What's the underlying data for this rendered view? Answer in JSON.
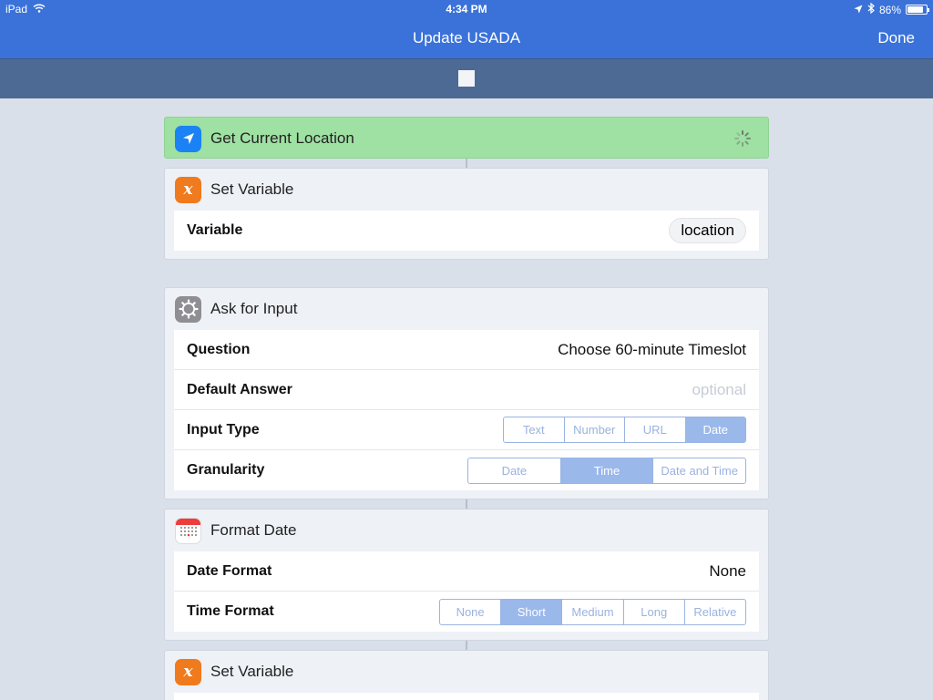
{
  "status": {
    "device": "iPad",
    "time": "4:34 PM",
    "battery": "86%",
    "battery_level": 0.86
  },
  "nav": {
    "title": "Update USADA",
    "done": "Done"
  },
  "actions": {
    "get_location": {
      "title": "Get Current Location",
      "color": "#9fe0a3"
    },
    "set_variable_1": {
      "title": "Set Variable",
      "variable_label": "Variable",
      "variable_value": "location"
    },
    "ask_input": {
      "title": "Ask for Input",
      "question_label": "Question",
      "question_value": "Choose 60-minute Timeslot",
      "default_label": "Default Answer",
      "default_placeholder": "optional",
      "input_type_label": "Input Type",
      "input_types": [
        "Text",
        "Number",
        "URL",
        "Date"
      ],
      "input_type_selected": "Date",
      "granularity_label": "Granularity",
      "granularities": [
        "Date",
        "Time",
        "Date and Time"
      ],
      "granularity_selected": "Time"
    },
    "format_date": {
      "title": "Format Date",
      "date_format_label": "Date Format",
      "date_format_value": "None",
      "time_format_label": "Time Format",
      "time_formats": [
        "None",
        "Short",
        "Medium",
        "Long",
        "Relative"
      ],
      "time_format_selected": "Short"
    },
    "set_variable_2": {
      "title": "Set Variable"
    }
  },
  "colors": {
    "nav_blue": "#3a72d9",
    "run_bar": "#4d6a94",
    "accent": "#9ab8ea",
    "variable_orange": "#f07a1e"
  }
}
